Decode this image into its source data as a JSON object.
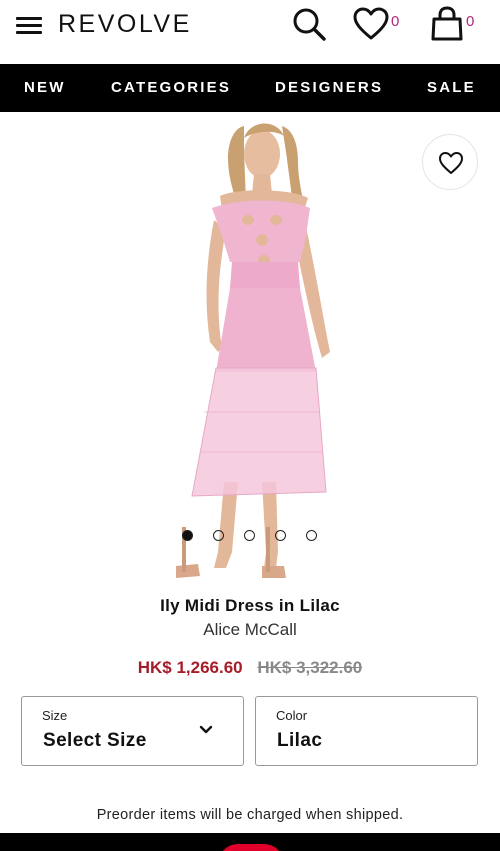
{
  "header": {
    "logo": "REVOLVE",
    "wishlist_count": "0",
    "bag_count": "0",
    "icons": {
      "menu": "hamburger-icon",
      "search": "search-icon",
      "wishlist": "heart-icon",
      "bag": "shopping-bag-icon"
    }
  },
  "nav": {
    "items": [
      {
        "label": "NEW"
      },
      {
        "label": "CATEGORIES"
      },
      {
        "label": "DESIGNERS"
      },
      {
        "label": "SALE"
      }
    ]
  },
  "gallery": {
    "slide_count": 5,
    "active_slide": 1,
    "favorite_icon": "heart-outline-icon",
    "dress_color": "#f0b6d0",
    "skin_color": "#e3b79a",
    "hair_color": "#c9a170"
  },
  "product": {
    "name": "Ily Midi Dress in Lilac",
    "designer": "Alice McCall",
    "sale_price": "HK$ 1,266.60",
    "original_price": "HK$ 3,322.60",
    "sale_color": "#a61c28"
  },
  "selectors": {
    "size": {
      "label": "Size",
      "value": "Select Size"
    },
    "color": {
      "label": "Color",
      "value": "Lilac"
    }
  },
  "notice": "Preorder items will be charged when shipped.",
  "brand_accent": "#b0297a"
}
